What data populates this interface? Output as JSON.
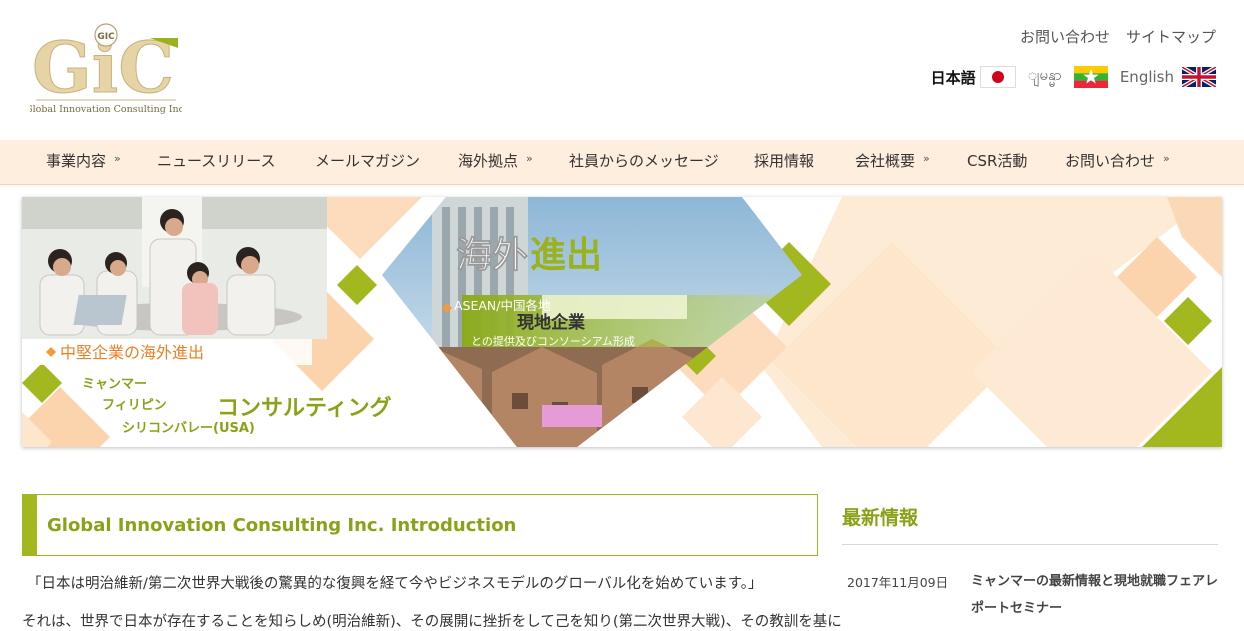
{
  "logo": {
    "letters": "GiC",
    "badge": "GIC",
    "subtitle": "Global Innovation Consulting Inc."
  },
  "header": {
    "links": [
      "お問い合わせ",
      "サイトマップ"
    ],
    "languages": {
      "japanese": "日本語",
      "myanmar": "ျမန္မာ",
      "english": "English"
    }
  },
  "nav": [
    {
      "label": "事業内容",
      "has_submenu": true
    },
    {
      "label": "ニュースリリース",
      "has_submenu": false
    },
    {
      "label": "メールマガジン",
      "has_submenu": false
    },
    {
      "label": "海外拠点",
      "has_submenu": true
    },
    {
      "label": "社員からのメッセージ",
      "has_submenu": false
    },
    {
      "label": "採用情報",
      "has_submenu": false
    },
    {
      "label": "会社概要",
      "has_submenu": true
    },
    {
      "label": "CSR活動",
      "has_submenu": false
    },
    {
      "label": "お問い合わせ",
      "has_submenu": true
    }
  ],
  "nav_chevron": "»",
  "banner": {
    "headline_a": "海外",
    "headline_b": "進出",
    "asean": "ASEAN/中国各地",
    "local": "現地企業",
    "partner": "との提供及びコンソーシアム形成",
    "mid_company": "中堅企業の海外進出",
    "countries": [
      "ミャンマー",
      "フィリピン",
      "シリコンバレー(USA)"
    ],
    "consulting": "コンサルティング"
  },
  "intro": {
    "title": "Global Innovation Consulting Inc. Introduction",
    "p1": "「日本は明治維新/第二次世界大戦後の驚異的な復興を経て今やビジネスモデルのグローバル化を始めています。」",
    "p2": "それは、世界で日本が存在することを知らしめ(明治維新)、その展開に挫折をして己を知り(第二次世界大戦)、その教訓を基に"
  },
  "sidebar": {
    "title": "最新情報",
    "news": [
      {
        "date": "2017年11月09日",
        "title": "ミャンマーの最新情報と現地就職フェアレポートセミナー"
      }
    ]
  },
  "colors": {
    "accent_green": "#a3b71f",
    "title_green": "#8aa218",
    "nav_bg": "#fdeedd",
    "banner_orange": "#f39a3c",
    "peach": "#fbd7b4"
  }
}
